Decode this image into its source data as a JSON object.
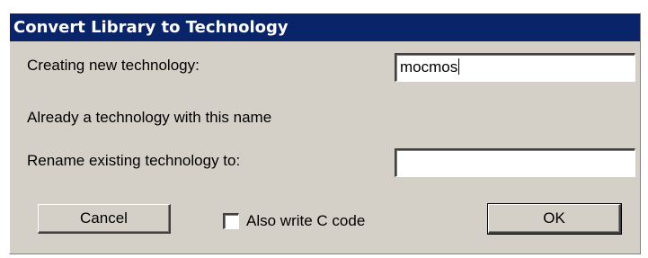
{
  "dialog": {
    "title": "Convert Library to Technology",
    "new_tech_label": "Creating new technology:",
    "new_tech_value": "mocmos",
    "warning_text": "Already a technology with this name",
    "rename_label": "Rename existing technology to:",
    "rename_value": "",
    "cancel_label": "Cancel",
    "checkbox_label": "Also write C code",
    "checkbox_checked": false,
    "ok_label": "OK"
  },
  "colors": {
    "titlebar": "#0a246a",
    "face": "#d4d0c8"
  }
}
